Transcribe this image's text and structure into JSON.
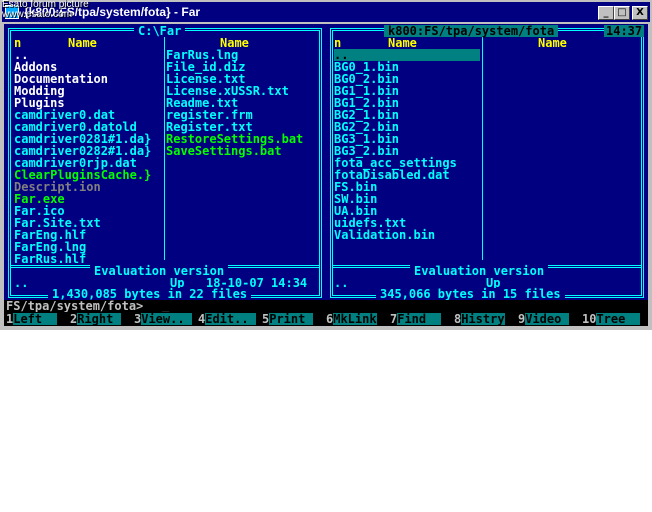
{
  "watermark": {
    "line1": "Esato forum picture",
    "line2": "www.esato.com"
  },
  "window": {
    "title": "{k800:FS/tpa/system/fota} - Far",
    "minimize": "_",
    "maximize": "□",
    "close": "X"
  },
  "left_panel": {
    "path": "C:\\Far",
    "col1": {
      "n": "n",
      "name": "Name",
      "items": [
        {
          "name": "..",
          "color": "white"
        },
        {
          "name": "Addons",
          "color": "white"
        },
        {
          "name": "Documentation",
          "color": "white"
        },
        {
          "name": "Modding",
          "color": "white"
        },
        {
          "name": "Plugins",
          "color": "white"
        },
        {
          "name": "camdriver0.dat",
          "color": "cyan"
        },
        {
          "name": "camdriver0.datold",
          "color": "cyan"
        },
        {
          "name": "camdriver0281#1.da}",
          "color": "cyan"
        },
        {
          "name": "camdriver0282#1.da}",
          "color": "cyan"
        },
        {
          "name": "camdriver0rjp.dat",
          "color": "cyan"
        },
        {
          "name": "ClearPluginsCache.}",
          "color": "green"
        },
        {
          "name": "Descript.ion",
          "color": "gray"
        },
        {
          "name": "Far.exe",
          "color": "green"
        },
        {
          "name": "Far.ico",
          "color": "cyan"
        },
        {
          "name": "Far.Site.txt",
          "color": "cyan"
        },
        {
          "name": "FarEng.hlf",
          "color": "cyan"
        },
        {
          "name": "FarEng.lng",
          "color": "cyan"
        },
        {
          "name": "FarRus.hlf",
          "color": "cyan"
        }
      ]
    },
    "col2": {
      "name": "Name",
      "items": [
        {
          "name": "FarRus.lng",
          "color": "cyan"
        },
        {
          "name": "File_id.diz",
          "color": "cyan"
        },
        {
          "name": "License.txt",
          "color": "cyan"
        },
        {
          "name": "License.xUSSR.txt",
          "color": "cyan"
        },
        {
          "name": "Readme.txt",
          "color": "cyan"
        },
        {
          "name": "register.frm",
          "color": "cyan"
        },
        {
          "name": "Register.txt",
          "color": "cyan"
        },
        {
          "name": "RestoreSettings.bat",
          "color": "green"
        },
        {
          "name": "SaveSettings.bat",
          "color": "green"
        }
      ]
    },
    "eval": "Evaluation version",
    "info_name": "..",
    "info_up": "Up",
    "info_date": "18-10-07 14:34",
    "summary": "1,430,085 bytes in 22 files"
  },
  "right_panel": {
    "path": "k800:FS/tpa/system/fota",
    "clock": "14:37",
    "col1": {
      "n": "n",
      "name": "Name",
      "items": [
        {
          "name": "..",
          "color": "white",
          "selected": true
        },
        {
          "name": "BG0_1.bin",
          "color": "cyan"
        },
        {
          "name": "BG0_2.bin",
          "color": "cyan"
        },
        {
          "name": "BG1_1.bin",
          "color": "cyan"
        },
        {
          "name": "BG1_2.bin",
          "color": "cyan"
        },
        {
          "name": "BG2_1.bin",
          "color": "cyan"
        },
        {
          "name": "BG2_2.bin",
          "color": "cyan"
        },
        {
          "name": "BG3_1.bin",
          "color": "cyan"
        },
        {
          "name": "BG3_2.bin",
          "color": "cyan"
        },
        {
          "name": "fota_acc_settings",
          "color": "cyan"
        },
        {
          "name": "fotaDisabled.dat",
          "color": "cyan"
        },
        {
          "name": "FS.bin",
          "color": "cyan"
        },
        {
          "name": "SW.bin",
          "color": "cyan"
        },
        {
          "name": "UA.bin",
          "color": "cyan"
        },
        {
          "name": "uidefs.txt",
          "color": "cyan"
        },
        {
          "name": "Validation.bin",
          "color": "cyan"
        }
      ]
    },
    "col2": {
      "name": "Name"
    },
    "eval": "Evaluation version",
    "info_name": "..",
    "info_up": "Up",
    "summary": "345,066 bytes in 15 files"
  },
  "command_line": {
    "prompt": "FS/tpa/system/fota>",
    "cursor": "_"
  },
  "keybar": [
    {
      "num": "1",
      "label": "Left  "
    },
    {
      "num": "2",
      "label": "Right "
    },
    {
      "num": "3",
      "label": "View.. "
    },
    {
      "num": "4",
      "label": "Edit.. "
    },
    {
      "num": "5",
      "label": "Print "
    },
    {
      "num": "6",
      "label": "MkLink"
    },
    {
      "num": "7",
      "label": "Find  "
    },
    {
      "num": "8",
      "label": "Histry"
    },
    {
      "num": "9",
      "label": "Video "
    },
    {
      "num": "10",
      "label": "Tree  "
    }
  ]
}
